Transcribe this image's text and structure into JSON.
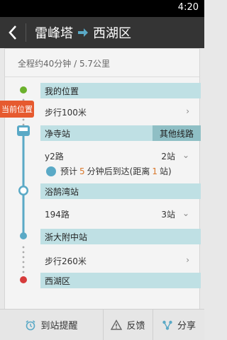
{
  "statusbar": {
    "time": "4:20"
  },
  "header": {
    "from": "雷峰塔",
    "to": "西湖区"
  },
  "summary": {
    "text": "全程约40分钟 / 5.7公里"
  },
  "badge": {
    "label": "当前位置"
  },
  "route": {
    "my_location": "我的位置",
    "walk1": "步行100米",
    "station1": "净寺站",
    "other_lines": "其他线路",
    "bus1": {
      "line": "y2路",
      "stops": "2站"
    },
    "eta": {
      "prefix": "预计",
      "minutes": "5",
      "middle": "分钟后到达(距离",
      "distance": "1",
      "suffix": "站)"
    },
    "station2": "浴鹄湾站",
    "bus2": {
      "line": "194路",
      "stops": "3站"
    },
    "station3": "浙大附中站",
    "walk2": "步行260米",
    "destination": "西湖区"
  },
  "bottom": {
    "remind": "到站提醒",
    "feedback": "反馈",
    "share": "分享"
  },
  "colors": {
    "accent": "#bfe0e4",
    "walk_dot": "#6bb12c",
    "end_dot": "#d63b3b",
    "rail": "#5aa9c6",
    "badge": "#e65a2f"
  }
}
